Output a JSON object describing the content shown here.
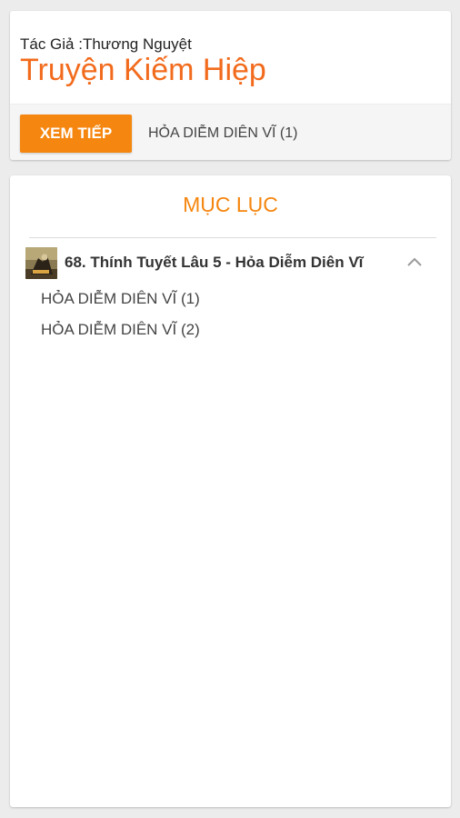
{
  "header": {
    "author_line": "Tác Giả :Thương Nguyệt",
    "title": "Truyện Kiếm Hiệp",
    "continue_button": "XEM TIẾP",
    "continue_chapter": "HỎA DIỄM DIÊN VĨ (1)"
  },
  "toc": {
    "title": "MỤC LỤC",
    "book": {
      "title": "68. Thính Tuyết Lâu 5 - Hỏa Diễm Diên Vĩ",
      "thumbnail_icon": "book-cover-thumbnail",
      "toggle_icon": "chevron-up-icon",
      "chapters": [
        {
          "label": "HỎA DIỄM DIÊN VĨ (1)"
        },
        {
          "label": "HỎA DIỄM DIÊN VĨ (2)"
        }
      ]
    }
  },
  "colors": {
    "accent": "#f5860f",
    "title": "#f26b1d",
    "background": "#ececec",
    "card": "#ffffff",
    "action_bar": "#f5f5f5"
  }
}
